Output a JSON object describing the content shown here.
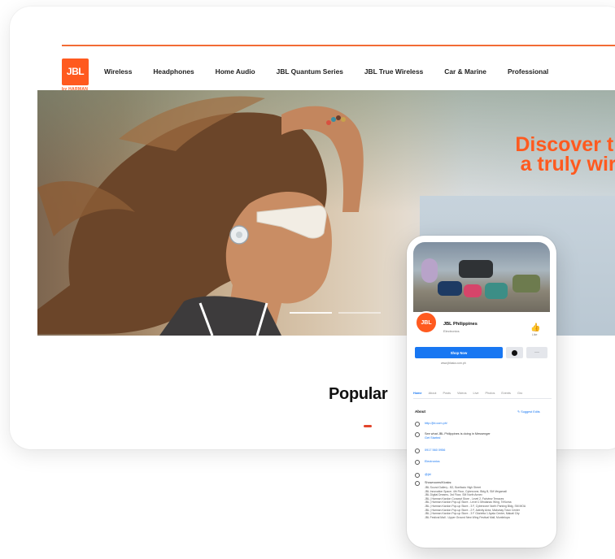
{
  "brand": {
    "logo_text": "JBL",
    "logo_sub": "by HARMAN",
    "accent_color": "#ff5a1f"
  },
  "nav": {
    "items": [
      "Wireless",
      "Headphones",
      "Home Audio",
      "JBL Quantum Series",
      "JBL True Wireless",
      "Car & Marine",
      "Professional"
    ]
  },
  "hero": {
    "title_line1": "Discover the f",
    "title_line2": "a truly wirele"
  },
  "section": {
    "popular_title": "Popular"
  },
  "facebook": {
    "page_name": "JBL Philippines",
    "category": "Electronics",
    "like_label": "Like",
    "shop_button": "Shop Now",
    "more_label": "···",
    "website_small": "www.jblasia.com.ph",
    "tabs": [
      "Home",
      "About",
      "Posts",
      "Videos",
      "Live",
      "Photos",
      "Events",
      "Gro"
    ],
    "about_title": "About",
    "suggest_edits": "Suggest Edits",
    "info": {
      "website": "http://jbl.com.ph/",
      "messenger_text": "See what JBL Philippines is doing in Messenger",
      "messenger_link": "Get Started",
      "phone": "0917 560 0956",
      "category_link": "Electronics",
      "jbl_link": "@jbl",
      "stores_heading": "Showrooms/Kiosks:"
    },
    "stores": [
      "JBL Sound Gallery - B2, Bonifacio High Street",
      "JBL Innovation Space- 4th Floor, Cyberzone, Bldg B, SM Megamall",
      "JBL Digital Dreams- 3rd Floor, SM North Annex",
      "JBL | Harman Kardon Concept Store - Level 2, Fairview Terraces",
      "JBL | Harman Kardon Pop-up Store - Level 1 Mindanao Wing, TriNoma",
      "JBL | Harman Kardon Pop-up Store - 3 F, Cyberzone North Parking Bldg, SM MOA",
      "JBL | Harman Kardon Pop-up Store - 2 F, Activity Area, Mabuhay Town Center",
      "JBL | Harman Kardon Pop-up Store - 3 F Glorietta 1 Ayala Center, Makati City",
      "JBL Festival Mall - Upper Ground New Wing Festival Mall, Muntinlupa"
    ]
  }
}
